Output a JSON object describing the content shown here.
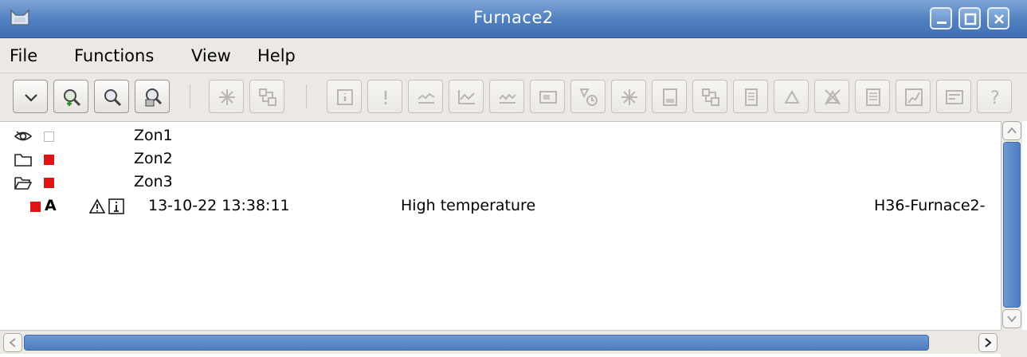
{
  "window": {
    "title": "Furnace2",
    "buttons": [
      "minimize-icon",
      "maximize-icon",
      "close-icon"
    ]
  },
  "menu": [
    {
      "label": "File"
    },
    {
      "label": "Functions"
    },
    {
      "label": "View"
    },
    {
      "label": "Help"
    }
  ],
  "toolbar": {
    "groups": [
      [
        "collapse-icon",
        "zoom-in-icon",
        "zoom-reset-icon",
        "search-object-icon"
      ],
      [
        "object-graph-icon",
        "hierarchy-icon"
      ],
      [
        "info-icon",
        "alarm-icon",
        "trend-icon",
        "curve-icon",
        "fast-curve-icon",
        "display-icon",
        "history-icon",
        "graph-icon",
        "open-object-icon",
        "crossref-icon",
        "document-icon",
        "acknowledge-icon",
        "block-icon",
        "event-log-icon",
        "plot-icon",
        "settings-icon",
        "help-icon"
      ]
    ]
  },
  "tree": {
    "rows": [
      {
        "name": "Zon1",
        "icon": "eye-icon",
        "status": "empty"
      },
      {
        "name": "Zon2",
        "icon": "folder-icon",
        "status": "red"
      },
      {
        "name": "Zon3",
        "icon": "folder-open-icon",
        "status": "red"
      }
    ],
    "alarm": {
      "priority": "A",
      "status_color": "#e01414",
      "icons": [
        "warning-icon",
        "info-box-icon"
      ],
      "time": "13-10-22 13:38:11",
      "text": "High temperature",
      "object": "H36-Furnace2-"
    }
  },
  "colors": {
    "titlebar": "#4f7fc0",
    "alarm_red": "#e01414",
    "scroll_thumb": "#4b7dc2"
  }
}
